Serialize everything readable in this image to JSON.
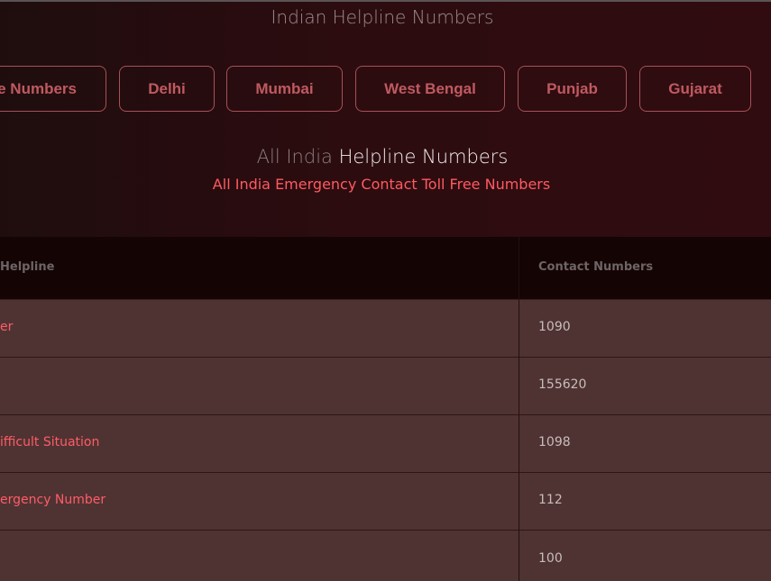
{
  "header": {
    "site_title": "Indian Helpline Numbers"
  },
  "region_tabs": [
    {
      "label": "e Numbers"
    },
    {
      "label": "Delhi"
    },
    {
      "label": "Mumbai"
    },
    {
      "label": "West Bengal"
    },
    {
      "label": "Punjab"
    },
    {
      "label": "Gujarat"
    }
  ],
  "section": {
    "heading_light": "All India",
    "heading_strong": "Helpline Numbers",
    "subheading": "All India Emergency Contact Toll Free Numbers"
  },
  "table": {
    "columns": [
      "Helpline",
      "Contact Numbers"
    ],
    "rows": [
      {
        "name": "er",
        "number": "1090"
      },
      {
        "name": "",
        "number": "155620"
      },
      {
        "name": "ifficult Situation",
        "number": "1098"
      },
      {
        "name": "ergency Number",
        "number": "112"
      },
      {
        "name": "",
        "number": "100"
      }
    ]
  },
  "colors": {
    "accent": "#ff5c66",
    "pill_border": "#a65158",
    "row_background": "#4f3333",
    "header_background": "#150404"
  }
}
